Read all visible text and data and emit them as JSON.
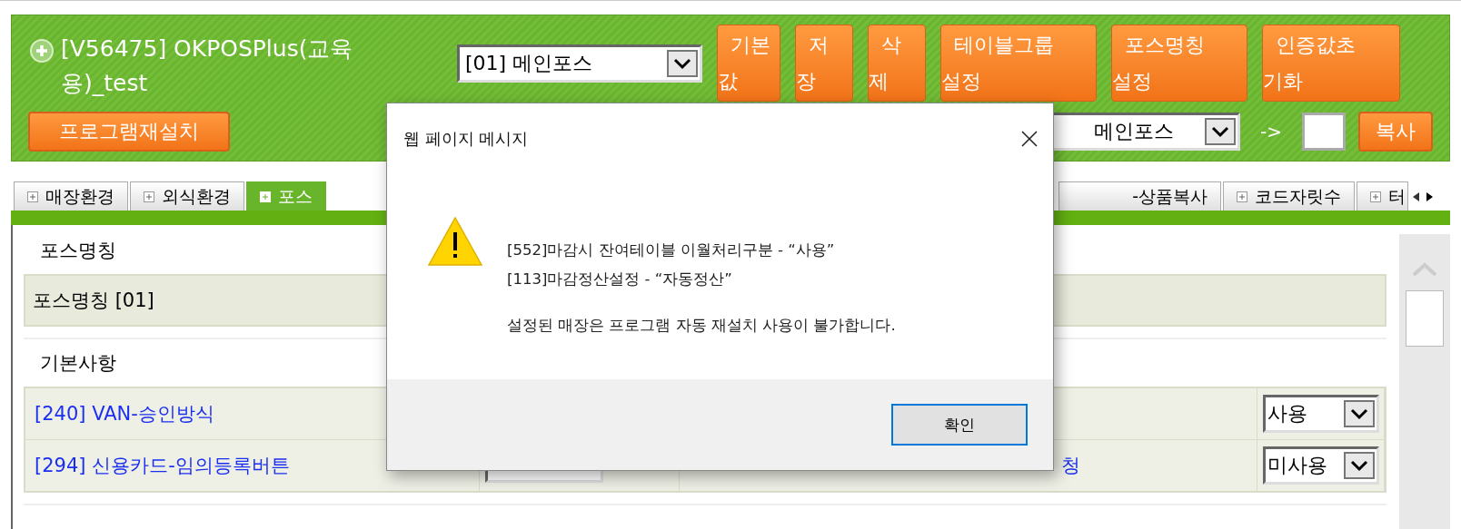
{
  "header": {
    "title": "[V56475] OKPOSPlus(교육용)_test",
    "pos_select": {
      "value": "[01] 메인포스"
    },
    "buttons": [
      {
        "lines": [
          "기본",
          "값"
        ]
      },
      {
        "lines": [
          "저",
          "장"
        ]
      },
      {
        "lines": [
          "삭",
          "제"
        ]
      },
      {
        "lines": [
          "테이블그룹",
          "설정"
        ]
      },
      {
        "lines": [
          "포스명칭",
          "설정"
        ]
      },
      {
        "lines": [
          "인증값초",
          "기화"
        ]
      }
    ],
    "reinstall_button": "프로그램재설치",
    "copy_source": {
      "value": "메인포스"
    },
    "copy_arrow": "->",
    "copy_button": "복사"
  },
  "tabs_left": [
    {
      "label": "매장환경",
      "selected": false
    },
    {
      "label": "외식환경",
      "selected": false
    },
    {
      "label": "포스",
      "selected": true
    }
  ],
  "tabs_right": [
    {
      "label": "-상품복사",
      "selected": false,
      "icon": false
    },
    {
      "label": "코드자릿수",
      "selected": false,
      "icon": true
    },
    {
      "label": "터",
      "selected": false,
      "icon": true
    }
  ],
  "sections": [
    {
      "legend": "포스명칭",
      "rows": [
        {
          "kind": "text",
          "text": "포스명칭 [01]"
        }
      ]
    },
    {
      "legend": "기본사항",
      "rows": [
        {
          "kind": "setting",
          "label": "[240] VAN-승인방식",
          "middle_link": "",
          "value": "사용"
        },
        {
          "kind": "setting_with_select",
          "label": "[294] 신용카드-임의등록버튼",
          "middle_link": "청",
          "value": "미사용"
        }
      ]
    }
  ],
  "dialog": {
    "title": "웹 페이지 메시지",
    "lines": [
      "[552]마감시 잔여테이블 이월처리구분 - “사용”",
      "[113]마감정산설정 - “자동정산”"
    ],
    "message": "설정된 매장은 프로그램 자동 재설치 사용이 불가합니다.",
    "button": "확인"
  }
}
